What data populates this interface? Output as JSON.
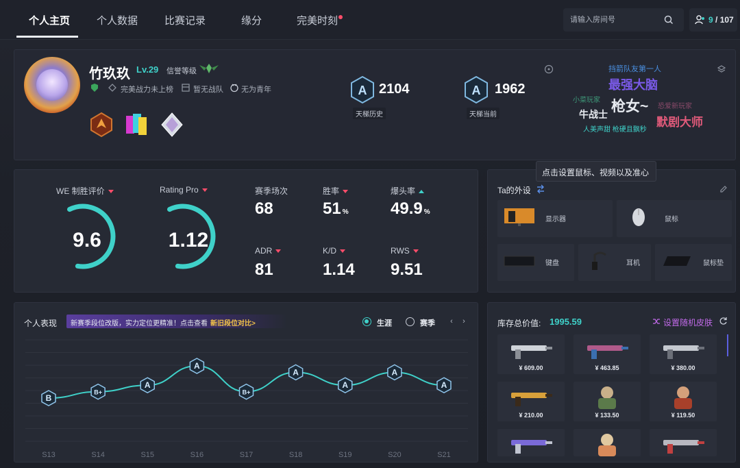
{
  "nav": {
    "tabs": [
      {
        "label": "个人主页"
      },
      {
        "label": "个人数据"
      },
      {
        "label": "比赛记录"
      },
      {
        "label": "缘分"
      },
      {
        "label": "完美时刻"
      }
    ],
    "search_placeholder": "请输入房间号",
    "friends_online": "9",
    "friends_total": "/ 107"
  },
  "profile": {
    "name": "竹玖玖",
    "level": "Lv.29",
    "credit_label": "信誉等级",
    "perfect_power": "完美战力未上榜",
    "team": "暂无战队",
    "youth": "无为青年",
    "ladder_history_score": "2104",
    "ladder_history_label": "天梯历史",
    "ladder_current_score": "1962",
    "ladder_current_label": "天梯当前",
    "rank_letter": "A",
    "tags": [
      {
        "text": "挡箭队友第一人",
        "color": "#4a8fe0"
      },
      {
        "text": "最强大脑",
        "color": "#7a5ae8"
      },
      {
        "text": "小菜玩家",
        "color": "#3f9a7a"
      },
      {
        "text": "牛战士",
        "color": "#e7eaf0"
      },
      {
        "text": "枪女~",
        "color": "#e7eaf0"
      },
      {
        "text": "恐爱新玩家",
        "color": "#8a4a6a"
      },
      {
        "text": "默剧大师",
        "color": "#e05a7a"
      },
      {
        "text": "人美声甜 枪硬且飘秒",
        "color": "#3fd1c9"
      }
    ]
  },
  "tooltip": "点击设置鼠标、视频以及准心",
  "ratings": {
    "we_label": "WE 制胜评价",
    "we_value": "9.6",
    "we_fraction": 0.6,
    "rating_label": "Rating Pro",
    "rating_value": "1.12",
    "rating_fraction": 0.6,
    "stats": [
      {
        "label": "赛季场次",
        "value": "68",
        "unit": "",
        "trend": "none"
      },
      {
        "label": "胜率",
        "value": "51",
        "unit": "%",
        "trend": "down"
      },
      {
        "label": "爆头率",
        "value": "49.9",
        "unit": "%",
        "trend": "up"
      },
      {
        "label": "ADR",
        "value": "81",
        "unit": "",
        "trend": "down"
      },
      {
        "label": "K/D",
        "value": "1.14",
        "unit": "",
        "trend": "down"
      },
      {
        "label": "RWS",
        "value": "9.51",
        "unit": "",
        "trend": "down"
      }
    ]
  },
  "gear": {
    "title": "Ta的外设",
    "items": [
      {
        "label": "显示器",
        "icon": "monitor-icon"
      },
      {
        "label": "鼠标",
        "icon": "mouse-icon"
      },
      {
        "label": "键盘",
        "icon": "keyboard-icon"
      },
      {
        "label": "耳机",
        "icon": "headset-icon"
      },
      {
        "label": "鼠标垫",
        "icon": "mousepad-icon"
      }
    ]
  },
  "performance": {
    "title": "个人表现",
    "notice": "新赛季段位改版，实力定位更精准！点击查看",
    "notice_link": "新旧段位对比>",
    "option_career": "生涯",
    "option_season": "赛季",
    "prev": "‹",
    "next": "›"
  },
  "chart_data": {
    "type": "line",
    "categories": [
      "S13",
      "S14",
      "S15",
      "S16",
      "S17",
      "S18",
      "S19",
      "S20",
      "S21"
    ],
    "ranks": [
      "B",
      "B+",
      "A",
      "A",
      "B+",
      "A",
      "A",
      "A",
      "A"
    ],
    "values": [
      1,
      2,
      3,
      6,
      2,
      5,
      3,
      5,
      3
    ],
    "series_color": "#3fd1c9",
    "grid": true
  },
  "inventory": {
    "title": "库存总价值:",
    "total": "1995.59",
    "random_skin": "设置随机皮肤",
    "items": [
      {
        "price": "¥ 609.00",
        "kind": "pistol-silver"
      },
      {
        "price": "¥ 463.85",
        "kind": "rifle-pink"
      },
      {
        "price": "¥ 380.00",
        "kind": "rifle-silver"
      },
      {
        "price": "¥ 210.00",
        "kind": "ak-gold"
      },
      {
        "price": "¥ 133.50",
        "kind": "agent-green"
      },
      {
        "price": "¥ 119.50",
        "kind": "agent-red"
      },
      {
        "price": "",
        "kind": "smg-purple"
      },
      {
        "price": "",
        "kind": "sticker-face"
      },
      {
        "price": "",
        "kind": "pistol-red"
      }
    ]
  }
}
